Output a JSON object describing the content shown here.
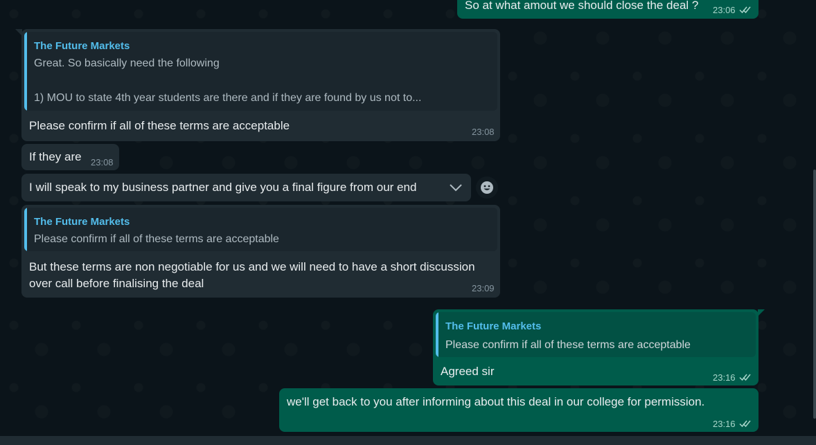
{
  "colors": {
    "background": "#0b141a",
    "incoming_bubble": "#202c33",
    "outgoing_bubble": "#005c4b",
    "quote_author": "#53bdeb",
    "read_ticks": "#53bdeb"
  },
  "messages": [
    {
      "direction": "outgoing",
      "text": "So at what amout we should close the deal ?",
      "time": "23:06",
      "status_icon": "double-check-icon"
    },
    {
      "direction": "incoming",
      "quote": {
        "author": "The Future Markets",
        "line1": "Great. So basically need the following",
        "line2": "1) MOU to state 4th year students are there and if they are found by us not to..."
      },
      "text": "Please confirm if all of these terms are acceptable",
      "time": "23:08"
    },
    {
      "direction": "incoming",
      "text": "If they are",
      "time": "23:08"
    },
    {
      "direction": "incoming",
      "text": "I will speak to my business partner and give you a final figure from our end",
      "menu_icon": "chevron-down-icon",
      "reaction_icon": "emoji-icon"
    },
    {
      "direction": "incoming",
      "quote": {
        "author": "The Future Markets",
        "line1": "Please confirm if all of these terms are acceptable"
      },
      "text_line1": "But these terms are non negotiable for us and we will need to have a short discussion",
      "text_line2": "over call before finalising the deal",
      "time": "23:09"
    },
    {
      "direction": "outgoing",
      "quote": {
        "author": "The Future Markets",
        "line1": "Please confirm if all of these terms are acceptable"
      },
      "text": "Agreed sir",
      "time": "23:16",
      "status_icon": "double-check-icon"
    },
    {
      "direction": "outgoing",
      "text": "we'll get back to you after informing about this deal in our college for permission.",
      "time": "23:16",
      "status_icon": "double-check-icon"
    }
  ]
}
